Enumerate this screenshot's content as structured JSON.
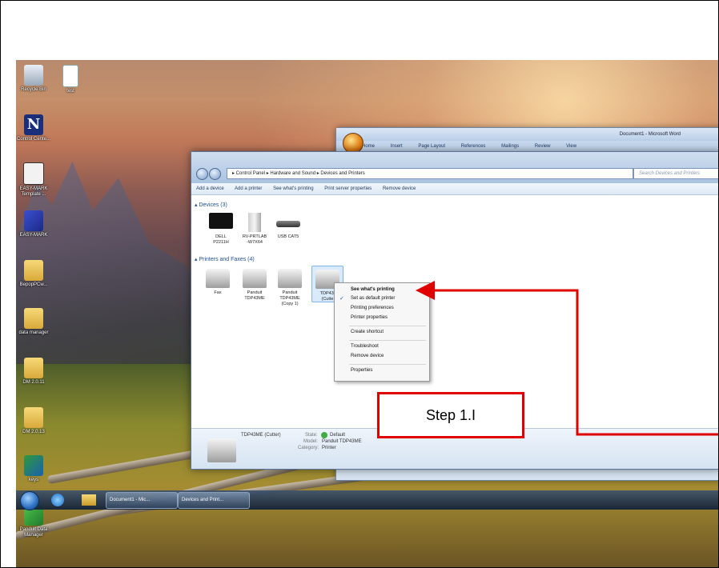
{
  "desktop": {
    "icons": [
      {
        "label": "Recycle Bin"
      },
      {
        "label": "test"
      },
      {
        "label": "Control Cente..."
      },
      {
        "label": "EASY-MARK Template ..."
      },
      {
        "label": "EASY-MARK"
      },
      {
        "label": "BepopPCw..."
      },
      {
        "label": "data manager"
      },
      {
        "label": "DM 2.0.11"
      },
      {
        "label": "DM 2.0.13"
      },
      {
        "label": "keys"
      },
      {
        "label": "Panduit Data Manager"
      }
    ]
  },
  "word": {
    "title": "Document1 - Microsoft Word",
    "tabs": [
      "Home",
      "Insert",
      "Page Layout",
      "References",
      "Mailings",
      "Review",
      "View"
    ]
  },
  "explorer": {
    "breadcrumb": "▸ Control Panel ▸ Hardware and Sound ▸ Devices and Printers",
    "search_placeholder": "Search Devices and Printers",
    "commands": [
      "Add a device",
      "Add a printer",
      "See what's printing",
      "Print server properties",
      "Remove device"
    ],
    "devices_header": "▴ Devices (3)",
    "devices": [
      {
        "line1": "DELL",
        "line2": "P2211H",
        "line3": ""
      },
      {
        "line1": "RV-PRTLAB",
        "line2": "-W7X64",
        "line3": ""
      },
      {
        "line1": "USB CAT5",
        "line2": "",
        "line3": ""
      }
    ],
    "printers_header": "▴ Printers and Faxes (4)",
    "printers": [
      {
        "line1": "Fax",
        "line2": "",
        "line3": ""
      },
      {
        "line1": "Panduit",
        "line2": "TDP43ME",
        "line3": ""
      },
      {
        "line1": "Panduit",
        "line2": "TDP43ME",
        "line3": "(Copy 1)"
      },
      {
        "line1": "TDP43I",
        "line2": "(Cutte",
        "line3": ""
      }
    ],
    "details": {
      "name": "TDP43ME (Cutter)",
      "state_label": "State:",
      "state_value": "Default",
      "model_label": "Model:",
      "model_value": "Panduit TDP43ME",
      "category_label": "Category:",
      "category_value": "Printer"
    }
  },
  "context_menu": {
    "items": [
      {
        "label": "See what's printing",
        "bold": true
      },
      {
        "label": "Set as default printer",
        "checked": true
      },
      {
        "label": "Printing preferences"
      },
      {
        "label": "Printer properties"
      },
      {
        "label": "Create shortcut"
      },
      {
        "label": "Troubleshoot"
      },
      {
        "label": "Remove device"
      },
      {
        "label": "Properties"
      }
    ],
    "check_glyph": "✓"
  },
  "taskbar": {
    "items": [
      {
        "label": "Document1 - Mic..."
      },
      {
        "label": "Devices and Print..."
      }
    ]
  },
  "callout": {
    "label": "Step 1.I",
    "color": "#e00000"
  }
}
